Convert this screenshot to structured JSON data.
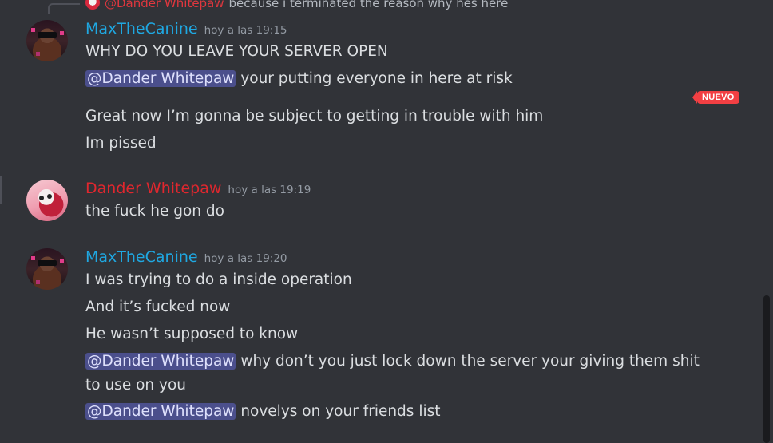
{
  "reply": {
    "author": "@Dander Whitepaw",
    "text": "because i terminated the reason why hes here"
  },
  "groups": [
    {
      "author": "MaxTheCanine",
      "timestamp": "hoy a las 19:15",
      "lines": [
        "WHY DO YOU LEAVE YOUR SERVER OPEN",
        "your putting everyone in here at risk",
        "Great now I’m gonna be subject to getting in trouble with him",
        "Im pissed"
      ]
    },
    {
      "author": "Dander Whitepaw",
      "timestamp": "hoy a las 19:19",
      "lines": [
        "the fuck he gon do"
      ]
    },
    {
      "author": "MaxTheCanine",
      "timestamp": "hoy a las 19:20",
      "lines": [
        "I was trying to do a inside operation",
        "And it’s fucked now",
        "He wasn’t supposed to know",
        "why don’t you just lock down the server your giving them shit to use on you",
        "novelys on your friends list"
      ]
    }
  ],
  "mention": "@Dander Whitepaw",
  "new_badge": "NUEVO",
  "colors": {
    "background": "#313338",
    "max_name": "#1fa8e2",
    "dander_name": "#e0272e",
    "mention_bg": "#4b4f8c",
    "new_divider": "#f23f43"
  }
}
